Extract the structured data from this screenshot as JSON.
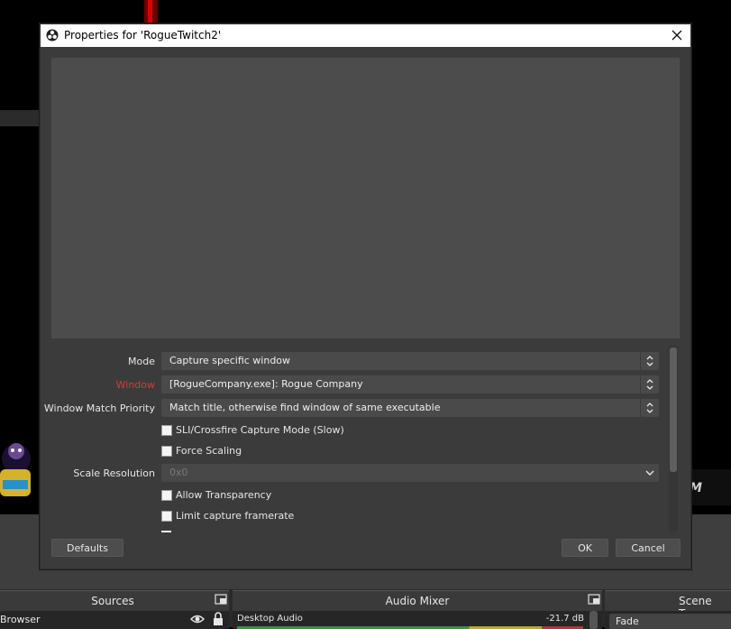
{
  "dialog": {
    "title": "Properties for 'RogueTwitch2'",
    "fields": {
      "mode": {
        "label": "Mode",
        "value": "Capture specific window"
      },
      "window": {
        "label": "Window",
        "value": "[RogueCompany.exe]: Rogue Company",
        "error_color": "#d33b3b"
      },
      "priority": {
        "label": "Window Match Priority",
        "value": "Match title, otherwise find window of same executable"
      },
      "sli": {
        "label": "SLI/Crossfire Capture Mode (Slow)",
        "checked": false
      },
      "force_scaling": {
        "label": "Force Scaling",
        "checked": false
      },
      "scale_resolution": {
        "label": "Scale Resolution",
        "value": "0x0",
        "disabled": true
      },
      "allow_transparency": {
        "label": "Allow Transparency",
        "checked": false
      },
      "limit_framerate": {
        "label": "Limit capture framerate",
        "checked": false
      }
    },
    "buttons": {
      "defaults": "Defaults",
      "ok": "OK",
      "cancel": "Cancel"
    }
  },
  "background": {
    "sources": {
      "title": "Sources",
      "item": "Browser"
    },
    "mixer": {
      "title": "Audio Mixer",
      "channel": "Desktop Audio",
      "level": "-21.7 dB"
    },
    "transitions": {
      "title": "Scene Trans",
      "selected": "Fade"
    },
    "side_glyph": "M"
  },
  "colors": {
    "accent_red": "#d70000",
    "dialog_bg": "#3b3b3b",
    "preview_bg": "#4c4c4c"
  }
}
